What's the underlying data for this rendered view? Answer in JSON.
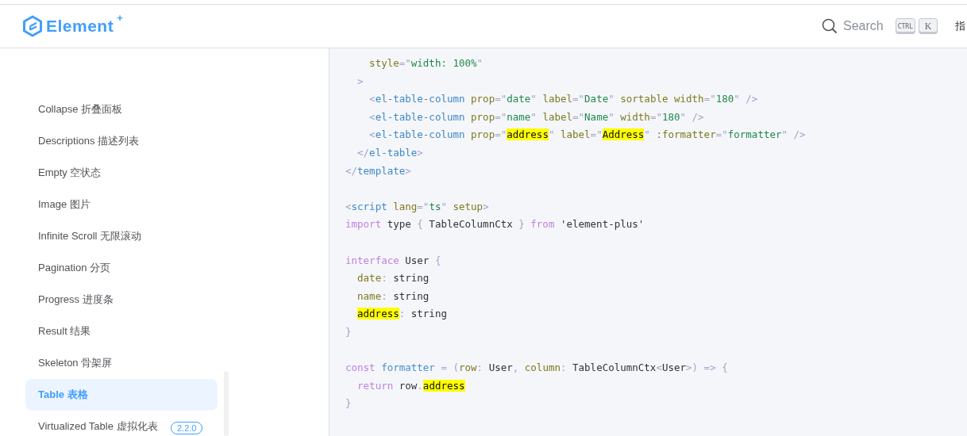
{
  "header": {
    "logo_text": "Element",
    "logo_mark": "+",
    "search": {
      "placeholder": "Search",
      "keys": [
        "CTRL",
        "K"
      ]
    },
    "nav_cut": "指"
  },
  "sidebar": {
    "items": [
      {
        "label": "Collapse 折叠面板",
        "selected": false
      },
      {
        "label": "Descriptions 描述列表",
        "selected": false
      },
      {
        "label": "Empty 空状态",
        "selected": false
      },
      {
        "label": "Image 图片",
        "selected": false
      },
      {
        "label": "Infinite Scroll 无限滚动",
        "selected": false
      },
      {
        "label": "Pagination 分页",
        "selected": false
      },
      {
        "label": "Progress 进度条",
        "selected": false
      },
      {
        "label": "Result 结果",
        "selected": false
      },
      {
        "label": "Skeleton 骨架屏",
        "selected": false
      },
      {
        "label": "Table 表格",
        "selected": true
      },
      {
        "label": "Virtualized Table 虚拟化表",
        "selected": false,
        "badge": "2.2.0"
      }
    ]
  },
  "code": {
    "lines": [
      {
        "kind": "code",
        "tokens": [
          {
            "kind": "attr",
            "text": "    style"
          },
          {
            "kind": "punct",
            "text": "=\""
          },
          {
            "kind": "str",
            "text": "width: 100%"
          },
          {
            "kind": "punct",
            "text": "\""
          }
        ]
      },
      {
        "kind": "code",
        "tokens": [
          {
            "kind": "punct",
            "text": "  >"
          }
        ]
      },
      {
        "kind": "code",
        "tokens": [
          {
            "kind": "punct",
            "text": "    <"
          },
          {
            "kind": "tag",
            "text": "el-table-column"
          },
          {
            "kind": "attr",
            "text": " prop"
          },
          {
            "kind": "punct",
            "text": "=\""
          },
          {
            "kind": "str",
            "text": "date"
          },
          {
            "kind": "punct",
            "text": "\""
          },
          {
            "kind": "attr",
            "text": " label"
          },
          {
            "kind": "punct",
            "text": "=\""
          },
          {
            "kind": "str",
            "text": "Date"
          },
          {
            "kind": "punct",
            "text": "\""
          },
          {
            "kind": "attr",
            "text": " sortable width"
          },
          {
            "kind": "punct",
            "text": "=\""
          },
          {
            "kind": "str",
            "text": "180"
          },
          {
            "kind": "punct",
            "text": "\" />"
          }
        ]
      },
      {
        "kind": "code",
        "tokens": [
          {
            "kind": "punct",
            "text": "    <"
          },
          {
            "kind": "tag",
            "text": "el-table-column"
          },
          {
            "kind": "attr",
            "text": " prop"
          },
          {
            "kind": "punct",
            "text": "=\""
          },
          {
            "kind": "str",
            "text": "name"
          },
          {
            "kind": "punct",
            "text": "\""
          },
          {
            "kind": "attr",
            "text": " label"
          },
          {
            "kind": "punct",
            "text": "=\""
          },
          {
            "kind": "str",
            "text": "Name"
          },
          {
            "kind": "punct",
            "text": "\""
          },
          {
            "kind": "attr",
            "text": " width"
          },
          {
            "kind": "punct",
            "text": "=\""
          },
          {
            "kind": "str",
            "text": "180"
          },
          {
            "kind": "punct",
            "text": "\" />"
          }
        ]
      },
      {
        "kind": "code",
        "tokens": [
          {
            "kind": "punct",
            "text": "    <"
          },
          {
            "kind": "tag",
            "text": "el-table-column"
          },
          {
            "kind": "attr",
            "text": " prop"
          },
          {
            "kind": "punct",
            "text": "=\""
          },
          {
            "kind": "match",
            "text": "address"
          },
          {
            "kind": "punct",
            "text": "\""
          },
          {
            "kind": "attr",
            "text": " label"
          },
          {
            "kind": "punct",
            "text": "=\""
          },
          {
            "kind": "match",
            "text": "Address"
          },
          {
            "kind": "punct",
            "text": "\""
          },
          {
            "kind": "attr",
            "text": " :formatter"
          },
          {
            "kind": "punct",
            "text": "=\""
          },
          {
            "kind": "str",
            "text": "formatter"
          },
          {
            "kind": "punct",
            "text": "\" />"
          }
        ]
      },
      {
        "kind": "code",
        "tokens": [
          {
            "kind": "punct",
            "text": "  </"
          },
          {
            "kind": "tag",
            "text": "el-table"
          },
          {
            "kind": "punct",
            "text": ">"
          }
        ]
      },
      {
        "kind": "code",
        "tokens": [
          {
            "kind": "punct",
            "text": "</"
          },
          {
            "kind": "tag",
            "text": "template"
          },
          {
            "kind": "punct",
            "text": ">"
          }
        ]
      },
      {
        "kind": "blank"
      },
      {
        "kind": "code",
        "tokens": [
          {
            "kind": "punct",
            "text": "<"
          },
          {
            "kind": "tag",
            "text": "script"
          },
          {
            "kind": "attr",
            "text": " lang"
          },
          {
            "kind": "punct",
            "text": "=\""
          },
          {
            "kind": "str",
            "text": "ts"
          },
          {
            "kind": "punct",
            "text": "\""
          },
          {
            "kind": "attr",
            "text": " setup"
          },
          {
            "kind": "punct",
            "text": ">"
          }
        ]
      },
      {
        "kind": "code",
        "tokens": [
          {
            "kind": "kw",
            "text": "import"
          },
          {
            "kind": "plain",
            "text": " type "
          },
          {
            "kind": "punct",
            "text": "{"
          },
          {
            "kind": "plain",
            "text": " TableColumnCtx "
          },
          {
            "kind": "punct",
            "text": "}"
          },
          {
            "kind": "kw",
            "text": " from"
          },
          {
            "kind": "plain",
            "text": " 'element-plus'"
          }
        ]
      },
      {
        "kind": "blank"
      },
      {
        "kind": "code",
        "tokens": [
          {
            "kind": "kw",
            "text": "interface"
          },
          {
            "kind": "plain",
            "text": " User "
          },
          {
            "kind": "punct",
            "text": "{"
          }
        ]
      },
      {
        "kind": "code",
        "tokens": [
          {
            "kind": "attr",
            "text": "  date"
          },
          {
            "kind": "punct",
            "text": ":"
          },
          {
            "kind": "plain",
            "text": " string"
          }
        ]
      },
      {
        "kind": "code",
        "tokens": [
          {
            "kind": "attr",
            "text": "  name"
          },
          {
            "kind": "punct",
            "text": ":"
          },
          {
            "kind": "plain",
            "text": " string"
          }
        ]
      },
      {
        "kind": "code",
        "indented": true,
        "tokens": [
          {
            "kind": "match",
            "text": "address"
          },
          {
            "kind": "punct",
            "text": ":"
          },
          {
            "kind": "plain",
            "text": " string"
          }
        ]
      },
      {
        "kind": "code",
        "tokens": [
          {
            "kind": "punct",
            "text": "}"
          }
        ]
      },
      {
        "kind": "blank"
      },
      {
        "kind": "code",
        "tokens": [
          {
            "kind": "kw",
            "text": "const"
          },
          {
            "kind": "fn",
            "text": " formatter"
          },
          {
            "kind": "punct",
            "text": " = ("
          },
          {
            "kind": "attr",
            "text": "row"
          },
          {
            "kind": "punct",
            "text": ":"
          },
          {
            "kind": "plain",
            "text": " User"
          },
          {
            "kind": "punct",
            "text": ","
          },
          {
            "kind": "attr",
            "text": " column"
          },
          {
            "kind": "punct",
            "text": ":"
          },
          {
            "kind": "plain",
            "text": " TableColumnCtx"
          },
          {
            "kind": "punct",
            "text": "<"
          },
          {
            "kind": "plain",
            "text": "User"
          },
          {
            "kind": "punct",
            "text": ">) => {"
          }
        ]
      },
      {
        "kind": "code",
        "tokens": [
          {
            "kind": "kw",
            "text": "  return"
          },
          {
            "kind": "plain",
            "text": " row"
          },
          {
            "kind": "punct",
            "text": "."
          },
          {
            "kind": "match",
            "text": "address"
          }
        ]
      },
      {
        "kind": "code",
        "tokens": [
          {
            "kind": "punct",
            "text": "}"
          }
        ]
      }
    ]
  }
}
